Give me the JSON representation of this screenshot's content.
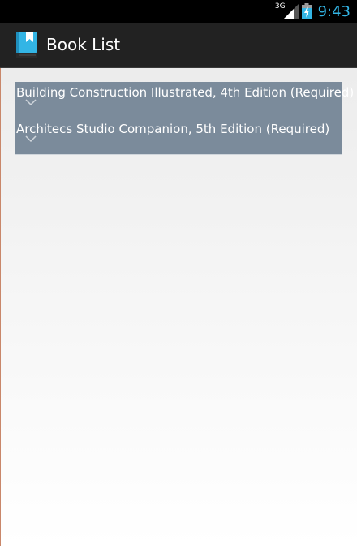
{
  "status_bar": {
    "network_type": "3G",
    "time": "9:43",
    "icons": [
      "signal-icon",
      "battery-charging-icon"
    ]
  },
  "action_bar": {
    "title": "Book List",
    "icon": "bookmark-book-icon"
  },
  "books": [
    {
      "title": "Building Construction Illustrated, 4th Edition (Required)"
    },
    {
      "title": "Architecs Studio Companion, 5th Edition (Required)"
    }
  ],
  "colors": {
    "status_bar_bg": "#000000",
    "clock": "#33b5e5",
    "action_bar_bg": "#222222",
    "app_icon": "#33b5e5",
    "row_bg": "#7b8b9b",
    "row_text": "#ffffff",
    "content_bg_top": "#ececec",
    "content_bg_bottom": "#ffffff"
  }
}
